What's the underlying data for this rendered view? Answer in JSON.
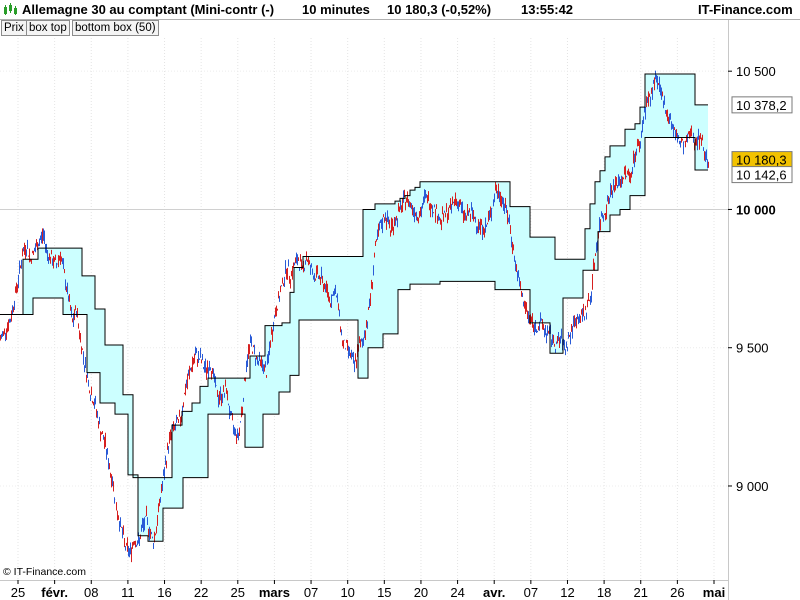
{
  "header": {
    "title": "Allemagne 30 au comptant (Mini-contr (-)",
    "interval": "10 minutes",
    "last_value": "10 180,3 (-0,52%)",
    "time": "13:55:42",
    "brand": "IT-Finance.com",
    "legend_chips": [
      "Prix",
      "box top",
      "bottom box (50)"
    ]
  },
  "copyright": "© IT-Finance.com",
  "colors": {
    "up": "#2a5bd7",
    "down": "#d62020",
    "band_fill": "#ccffff",
    "band_line": "#000000",
    "price_badge": "#f2c200"
  },
  "chart_data": {
    "type": "line",
    "ylim": [
      8660,
      10620
    ],
    "x_ticks": [
      {
        "label": "25",
        "bold": false
      },
      {
        "label": "févr.",
        "bold": true
      },
      {
        "label": "08",
        "bold": false
      },
      {
        "label": "11",
        "bold": false
      },
      {
        "label": "16",
        "bold": false
      },
      {
        "label": "22",
        "bold": false
      },
      {
        "label": "25",
        "bold": false
      },
      {
        "label": "mars",
        "bold": true
      },
      {
        "label": "07",
        "bold": false
      },
      {
        "label": "10",
        "bold": false
      },
      {
        "label": "15",
        "bold": false
      },
      {
        "label": "20",
        "bold": false
      },
      {
        "label": "24",
        "bold": false
      },
      {
        "label": "avr.",
        "bold": true
      },
      {
        "label": "07",
        "bold": false
      },
      {
        "label": "12",
        "bold": false
      },
      {
        "label": "18",
        "bold": false
      },
      {
        "label": "21",
        "bold": false
      },
      {
        "label": "26",
        "bold": false
      },
      {
        "label": "mai",
        "bold": true
      }
    ],
    "y_ticks": [
      {
        "label": "9 000",
        "value": 9000,
        "bold": false
      },
      {
        "label": "9 500",
        "value": 9500,
        "bold": false
      },
      {
        "label": "10 000",
        "value": 10000,
        "bold": true
      },
      {
        "label": "10 500",
        "value": 10500,
        "bold": false
      }
    ],
    "price_labels": [
      {
        "label": "10 378,2",
        "value": 10378.2,
        "highlight": false
      },
      {
        "label": "10 180,3",
        "value": 10180.3,
        "highlight": true
      },
      {
        "label": "10 142,6",
        "value": 10142.6,
        "highlight": false
      }
    ],
    "series": [
      {
        "x": [
          0,
          10,
          18,
          22,
          26,
          30,
          34,
          38,
          43,
          47,
          51,
          56,
          60,
          64,
          68,
          72,
          76,
          80,
          85,
          90,
          95,
          100,
          105,
          110,
          113,
          116,
          120,
          125,
          130,
          134,
          138,
          142,
          146,
          150,
          153,
          156,
          160,
          164,
          168,
          172,
          176,
          180,
          185,
          190,
          195,
          200,
          205,
          210,
          214,
          218,
          222,
          226,
          230,
          234,
          238,
          242,
          246,
          250,
          254,
          258,
          262,
          266,
          270,
          274,
          278,
          282,
          286,
          290,
          294,
          298,
          302,
          306,
          310,
          314,
          318,
          322,
          326,
          330,
          334,
          338,
          342,
          346,
          350,
          354,
          358,
          362,
          366,
          370,
          375,
          380,
          385,
          390,
          395,
          400,
          405,
          410,
          415,
          420,
          425,
          430,
          435,
          440,
          445,
          450,
          455,
          460,
          465,
          470,
          475,
          480,
          485,
          490,
          495,
          500,
          505,
          510,
          515,
          520,
          525,
          530,
          535,
          540,
          545,
          550,
          555,
          560,
          565,
          570,
          575,
          580,
          585,
          590,
          595,
          600,
          605,
          610,
          615,
          620,
          625,
          630,
          635,
          640,
          643,
          646,
          650,
          655,
          660,
          665,
          670,
          675,
          680,
          685,
          690,
          695,
          700,
          705,
          708
        ],
        "values": [
          9530,
          9600,
          9750,
          9840,
          9870,
          9820,
          9850,
          9880,
          9910,
          9840,
          9820,
          9800,
          9840,
          9760,
          9680,
          9590,
          9640,
          9530,
          9430,
          9340,
          9290,
          9200,
          9150,
          9050,
          9000,
          8920,
          8860,
          8780,
          8760,
          8810,
          8790,
          8850,
          8880,
          8830,
          8800,
          8850,
          8960,
          9050,
          9150,
          9200,
          9220,
          9240,
          9350,
          9420,
          9470,
          9460,
          9420,
          9440,
          9380,
          9320,
          9330,
          9350,
          9250,
          9200,
          9180,
          9290,
          9440,
          9520,
          9480,
          9450,
          9440,
          9410,
          9520,
          9610,
          9670,
          9730,
          9790,
          9760,
          9800,
          9820,
          9780,
          9830,
          9790,
          9760,
          9760,
          9740,
          9710,
          9670,
          9710,
          9650,
          9520,
          9500,
          9480,
          9430,
          9500,
          9520,
          9580,
          9680,
          9860,
          9940,
          9980,
          9930,
          9960,
          10000,
          10040,
          10020,
          9990,
          9980,
          10050,
          10020,
          10000,
          9960,
          9980,
          10000,
          10040,
          10010,
          9970,
          9990,
          9960,
          9940,
          9930,
          9980,
          10070,
          10050,
          10010,
          9930,
          9800,
          9710,
          9640,
          9600,
          9570,
          9590,
          9560,
          9540,
          9510,
          9530,
          9500,
          9550,
          9600,
          9610,
          9630,
          9680,
          9840,
          9960,
          10000,
          10060,
          10090,
          10100,
          10130,
          10120,
          10210,
          10240,
          10330,
          10390,
          10400,
          10480,
          10420,
          10370,
          10320,
          10270,
          10240,
          10230,
          10280,
          10250,
          10260,
          10200,
          10180
        ]
      },
      {
        "name": "box top",
        "x": [
          0,
          18,
          23,
          38,
          67,
          82,
          95,
          105,
          113,
          123,
          133,
          148,
          172,
          182,
          192,
          200,
          208,
          240,
          250,
          265,
          282,
          290,
          294,
          303,
          358,
          363,
          375,
          385,
          395,
          400,
          405,
          410,
          415,
          420,
          425,
          435,
          445,
          450,
          455,
          460,
          480,
          505,
          510,
          530,
          545,
          550,
          555,
          565,
          570,
          580,
          585,
          590,
          595,
          600,
          605,
          610,
          625,
          635,
          640,
          645,
          695,
          708
        ],
        "values": [
          9620,
          9620,
          9820,
          9860,
          9860,
          9760,
          9640,
          9510,
          9510,
          9330,
          9030,
          9030,
          9220,
          9270,
          9300,
          9360,
          9390,
          9390,
          9470,
          9580,
          9590,
          9700,
          9790,
          9830,
          9830,
          10000,
          10020,
          10020,
          10030,
          10040,
          10050,
          10070,
          10080,
          10100,
          10100,
          10100,
          10100,
          10100,
          10100,
          10100,
          10100,
          10100,
          10010,
          9900,
          9900,
          9900,
          9820,
          9820,
          9820,
          9820,
          9930,
          10020,
          10100,
          10140,
          10190,
          10230,
          10290,
          10310,
          10370,
          10490,
          10378.2,
          10378.2
        ]
      },
      {
        "name": "bottom box (50)",
        "x": [
          0,
          18,
          33,
          63,
          87,
          100,
          115,
          128,
          138,
          148,
          163,
          183,
          208,
          230,
          245,
          263,
          279,
          290,
          299,
          338,
          358,
          368,
          383,
          398,
          410,
          440,
          472,
          495,
          530,
          550,
          563,
          583,
          598,
          610,
          620,
          630,
          645,
          672,
          695,
          708
        ],
        "values": [
          9620,
          9620,
          9680,
          9620,
          9410,
          9300,
          9260,
          9040,
          8820,
          8800,
          8920,
          9030,
          9260,
          9260,
          9140,
          9260,
          9340,
          9400,
          9600,
          9600,
          9390,
          9500,
          9550,
          9710,
          9730,
          9740,
          9740,
          9710,
          9590,
          9480,
          9680,
          9780,
          9920,
          9980,
          10000,
          10050,
          10260,
          10260,
          10142.6,
          10142.6
        ]
      }
    ]
  }
}
